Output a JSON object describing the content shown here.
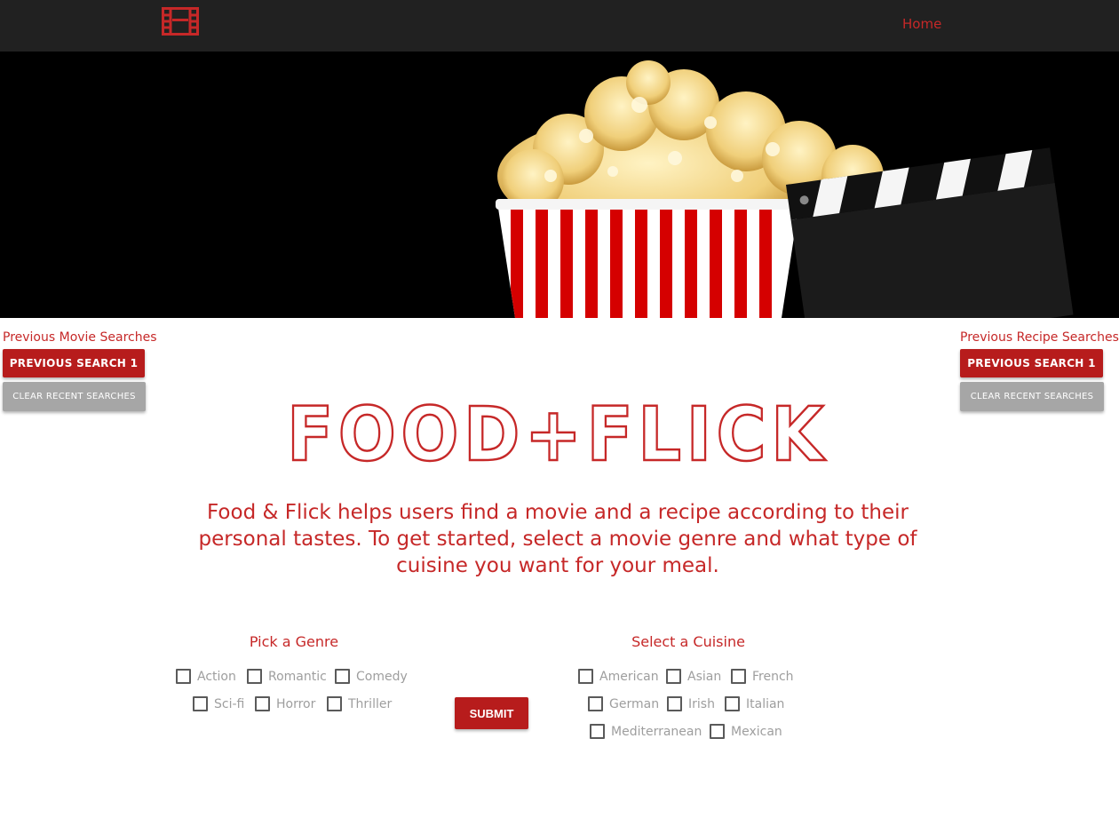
{
  "nav": {
    "home_label": "Home"
  },
  "left_panel": {
    "title": "Previous Movie Searches",
    "previous_search": "PREVIOUS SEARCH 1",
    "clear": "CLEAR RECENT SEARCHES"
  },
  "right_panel": {
    "title": "Previous Recipe Searches",
    "previous_search": "PREVIOUS SEARCH 1",
    "clear": "CLEAR RECENT SEARCHES"
  },
  "brand": {
    "title": "FOOD+FLICK"
  },
  "description": "Food & Flick helps users find a movie and a recipe according to their personal tastes. To get started, select a movie genre and what type of cuisine you want for your meal.",
  "genre": {
    "title": "Pick a Genre",
    "options": [
      "Action",
      "Romantic",
      "Comedy",
      "Sci-fi",
      "Horror",
      "Thriller"
    ]
  },
  "cuisine": {
    "title": "Select a Cuisine",
    "options": [
      "American",
      "Asian",
      "French",
      "German",
      "Irish",
      "Italian",
      "Mediterranean",
      "Mexican"
    ]
  },
  "submit_label": "SUBMIT",
  "colors": {
    "accent": "#b71c1c",
    "nav_bg": "#212121",
    "muted": "#9e9e9e"
  },
  "icons": {
    "logo": "film-strip-icon"
  }
}
